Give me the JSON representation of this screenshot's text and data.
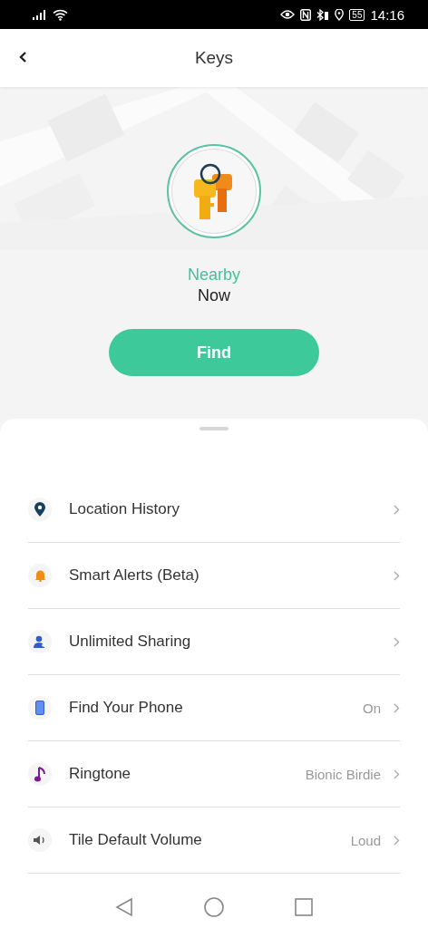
{
  "status_bar": {
    "battery": "55",
    "time": "14:16"
  },
  "header": {
    "title": "Keys"
  },
  "device": {
    "status": "Nearby",
    "time": "Now",
    "button": "Find"
  },
  "menu": [
    {
      "kind": "pin",
      "label": "Location History"
    },
    {
      "kind": "bell",
      "label": "Smart Alerts (Beta)"
    },
    {
      "kind": "person",
      "label": "Unlimited Sharing"
    },
    {
      "kind": "phone",
      "label": "Find Your Phone",
      "value": "On"
    },
    {
      "kind": "note",
      "label": "Ringtone",
      "value": "Bionic Birdie"
    },
    {
      "kind": "speaker",
      "label": "Tile Default Volume",
      "value": "Loud"
    }
  ]
}
